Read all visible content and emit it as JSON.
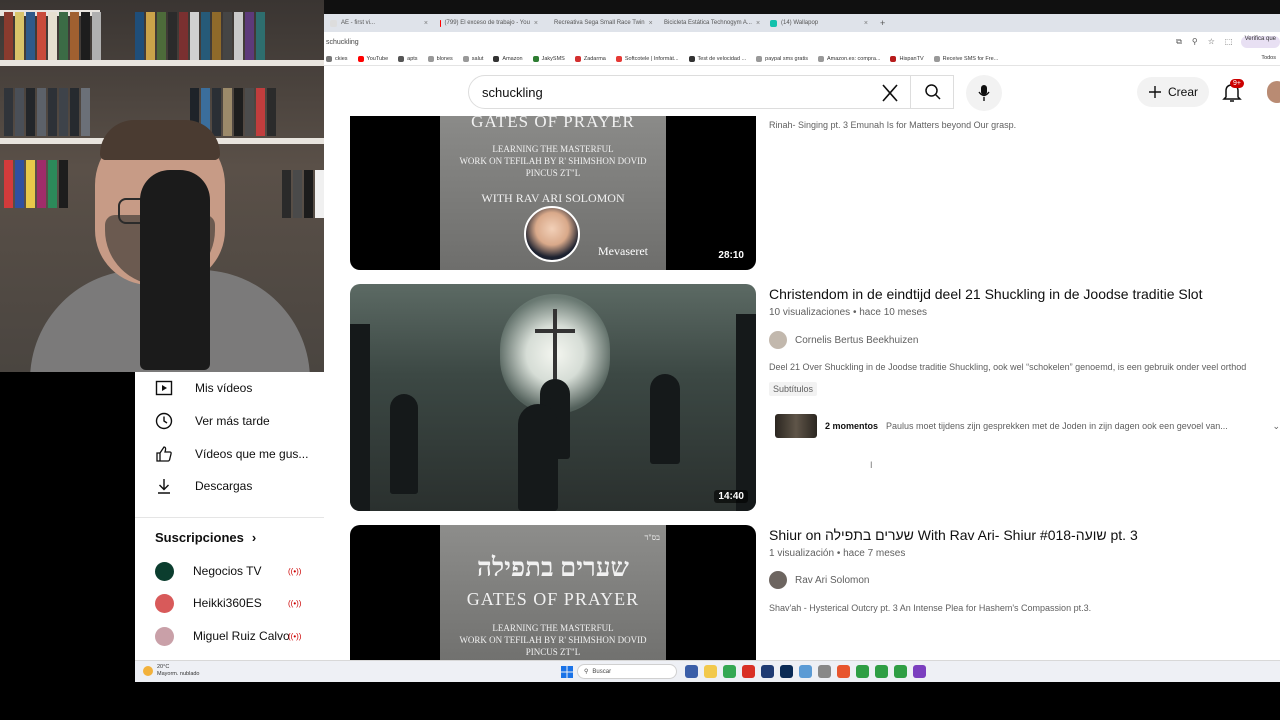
{
  "browser": {
    "tabs": [
      {
        "label": "AE - first vi...",
        "color": "#dddddd"
      },
      {
        "label": "(799) El exceso de trabajo - You",
        "color": "#ff0000"
      },
      {
        "label": "Recreativa Sega Small Race Twin",
        "color": "#1aa37a"
      },
      {
        "label": "Bicicleta Estática Technogym A...",
        "color": "#1aa37a"
      },
      {
        "label": "(14) Wallapop",
        "color": "#13c1ac"
      }
    ],
    "new_tab": "+",
    "address": "schuckling",
    "profile_chip": "Verifica que",
    "bookmarks": [
      {
        "label": "ckies",
        "color": "#777777"
      },
      {
        "label": "YouTube",
        "color": "#ff0000"
      },
      {
        "label": "apts",
        "color": "#555555"
      },
      {
        "label": "blones",
        "color": "#999999"
      },
      {
        "label": "salut",
        "color": "#999999"
      },
      {
        "label": "Amazon",
        "color": "#333333"
      },
      {
        "label": "JakySMS",
        "color": "#2e7d32"
      },
      {
        "label": "Zadarma",
        "color": "#d32f2f"
      },
      {
        "label": "Softcotele | Informàt...",
        "color": "#e53935"
      },
      {
        "label": "Test de velocidad ...",
        "color": "#333333"
      },
      {
        "label": "paypal sms gratis",
        "color": "#999999"
      },
      {
        "label": "Amazon.es: compra...",
        "color": "#999999"
      },
      {
        "label": "HispanTV",
        "color": "#b71c1c"
      },
      {
        "label": "Receive SMS for Fre...",
        "color": "#999999"
      }
    ],
    "bookmarks_right": "Todos"
  },
  "yt": {
    "search_query": "schuckling",
    "create_label": "Crear",
    "notif_badge": "9+"
  },
  "results": [
    {
      "thumb_lines": [
        "GATES OF PRAYER",
        "LEARNING THE MASTERFUL",
        "WORK ON TEFILAH BY R' SHIMSHON DOVID",
        "PINCUS ZT\"L",
        "WITH RAV ARI SOLOMON"
      ],
      "logo_text": "Mevaseret",
      "duration": "28:10",
      "description": "Rinah- Singing pt. 3 Emunah Is for Matters beyond Our grasp."
    },
    {
      "title": "Christendom in de eindtijd deel 21 Shuckling in de Joodse traditie Slot",
      "views": "10 visualizaciones",
      "age": "hace 10 meses",
      "channel": "Cornelis Bertus Beekhuizen",
      "description": "Deel 21 Over Shuckling in de Joodse traditie Shuckling, ook wel “schokelen” genoemd, is een gebruik onder veel orthod",
      "chip": "Subtítulos",
      "duration": "14:40",
      "moments_label": "2 momentos",
      "moments_text": "Paulus moet tijdens zijn gesprekken met de Joden in zijn dagen ook een gevoel van..."
    },
    {
      "title": "Shiur on שערים בתפילה With Rav Ari- Shiur #018-שועה pt. 3",
      "views": "1 visualización",
      "age": "hace 7 meses",
      "channel": "Rav Ari Solomon",
      "description": "Shav'ah - Hysterical Outcry pt. 3 An Intense Plea for Hashem's Compassion pt.3.",
      "thumb_hebrew": "שערים בתפילה",
      "thumb_corner": "בס\"ד",
      "thumb_lines": [
        "GATES OF PRAYER",
        "LEARNING THE MASTERFUL",
        "WORK ON TEFILAH BY R' SHIMSHON DOVID",
        "PINCUS ZT\"L"
      ]
    }
  ],
  "sidebar": {
    "items": [
      {
        "label": "Mis vídeos",
        "icon": "play-square-icon"
      },
      {
        "label": "Ver más tarde",
        "icon": "clock-icon"
      },
      {
        "label": "Vídeos que me gus...",
        "icon": "thumbs-up-icon"
      },
      {
        "label": "Descargas",
        "icon": "download-icon"
      }
    ],
    "subs_title": "Suscripciones",
    "subs": [
      {
        "label": "Negocios TV",
        "color": "#0b3d2e"
      },
      {
        "label": "Heikki360ES",
        "color": "#d85a5a"
      },
      {
        "label": "Miguel Ruiz Calvo",
        "color": "#c9a0a8"
      }
    ],
    "live_icon": "((•))"
  },
  "taskbar": {
    "weather_temp": "20°C",
    "weather_desc": "Mayorm. nublado",
    "search_placeholder": "Buscar",
    "app_colors": [
      "#3a5ea8",
      "#f2c94c",
      "#34a853",
      "#d93025",
      "#1f3b73",
      "#0a2a55",
      "#5b9bd5",
      "#888888",
      "#e8552d",
      "#2f9e44",
      "#2f9e44",
      "#2f9e44",
      "#7b3fbf"
    ]
  }
}
